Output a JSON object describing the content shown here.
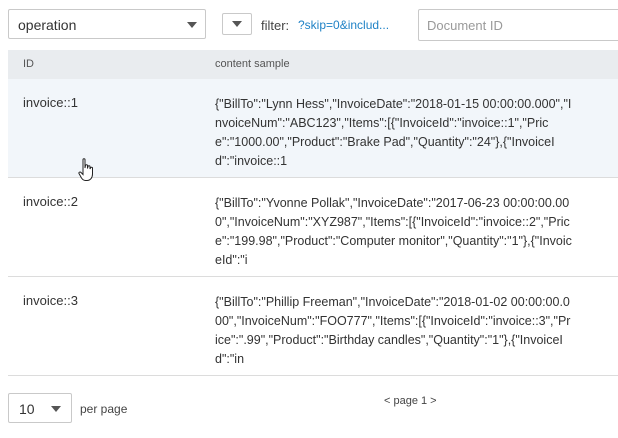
{
  "toolbar": {
    "view_select": "operation",
    "filter_label": "filter:",
    "filter_value": "?skip=0&includ...",
    "doc_id_placeholder": "Document ID"
  },
  "table": {
    "columns": [
      "ID",
      "content sample"
    ],
    "rows": [
      {
        "id": "invoice::1",
        "content": "{\"BillTo\":\"Lynn Hess\",\"InvoiceDate\":\"2018-01-15 00:00:00.000\",\"InvoiceNum\":\"ABC123\",\"Items\":[{\"InvoiceId\":\"invoice::1\",\"Price\":\"1000.00\",\"Product\":\"Brake Pad\",\"Quantity\":\"24\"},{\"InvoiceId\":\"invoice::1"
      },
      {
        "id": "invoice::2",
        "content": "{\"BillTo\":\"Yvonne Pollak\",\"InvoiceDate\":\"2017-06-23 00:00:00.000\",\"InvoiceNum\":\"XYZ987\",\"Items\":[{\"InvoiceId\":\"invoice::2\",\"Price\":\"199.98\",\"Product\":\"Computer monitor\",\"Quantity\":\"1\"},{\"InvoiceId\":\"i"
      },
      {
        "id": "invoice::3",
        "content": "{\"BillTo\":\"Phillip Freeman\",\"InvoiceDate\":\"2018-01-02 00:00:00.000\",\"InvoiceNum\":\"FOO777\",\"Items\":[{\"InvoiceId\":\"invoice::3\",\"Price\":\".99\",\"Product\":\"Birthday candles\",\"Quantity\":\"1\"},{\"InvoiceId\":\"in"
      }
    ]
  },
  "footer": {
    "per_page_value": "10",
    "per_page_label": "per page",
    "pager_text": "< page 1 >"
  },
  "colors": {
    "link": "#1f82c6",
    "header_bg": "#e9ecef",
    "hover_row_bg": "#f2f6fa"
  },
  "icons": [
    "chevron-down-icon",
    "pointer-hand-icon"
  ]
}
